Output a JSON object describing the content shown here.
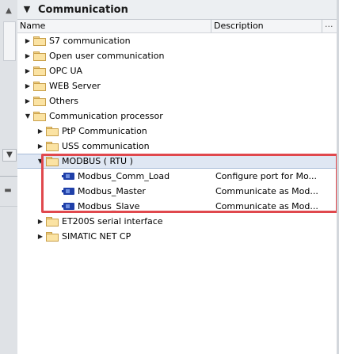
{
  "panel": {
    "title": "Communication",
    "columns": {
      "name": "Name",
      "description": "Description",
      "more": "..."
    }
  },
  "tree": [
    {
      "label": "S7 communication",
      "level": 0,
      "type": "folder",
      "expanded": false
    },
    {
      "label": "Open user communication",
      "level": 0,
      "type": "folder",
      "expanded": false
    },
    {
      "label": "OPC UA",
      "level": 0,
      "type": "folder",
      "expanded": false
    },
    {
      "label": "WEB Server",
      "level": 0,
      "type": "folder",
      "expanded": false
    },
    {
      "label": "Others",
      "level": 0,
      "type": "folder",
      "expanded": false
    },
    {
      "label": "Communication processor",
      "level": 0,
      "type": "folder",
      "expanded": true
    },
    {
      "label": "PtP Communication",
      "level": 1,
      "type": "folder",
      "expanded": false
    },
    {
      "label": "USS communication",
      "level": 1,
      "type": "folder",
      "expanded": false
    },
    {
      "label": "MODBUS ( RTU )",
      "level": 1,
      "type": "folder",
      "expanded": true,
      "selected": true
    },
    {
      "label": "Modbus_Comm_Load",
      "level": 2,
      "type": "block",
      "description": "Configure port for Mo..."
    },
    {
      "label": "Modbus_Master",
      "level": 2,
      "type": "block",
      "description": "Communicate as Mod..."
    },
    {
      "label": "Modbus_Slave",
      "level": 2,
      "type": "block",
      "description": "Communicate as Mod..."
    },
    {
      "label": "ET200S serial interface",
      "level": 1,
      "type": "folder",
      "expanded": false
    },
    {
      "label": "SIMATIC NET CP",
      "level": 1,
      "type": "folder",
      "expanded": false
    }
  ],
  "colors": {
    "highlight": "#e0484d",
    "selection": "#dfe7f3",
    "block_icon": "#1f3fa8",
    "folder": "#fbe3a3"
  },
  "icons": {
    "collapse": "chevron-down-icon",
    "expanded": "triangle-down-icon",
    "collapsed": "triangle-right-icon",
    "folder": "folder-icon",
    "block": "function-block-icon"
  }
}
